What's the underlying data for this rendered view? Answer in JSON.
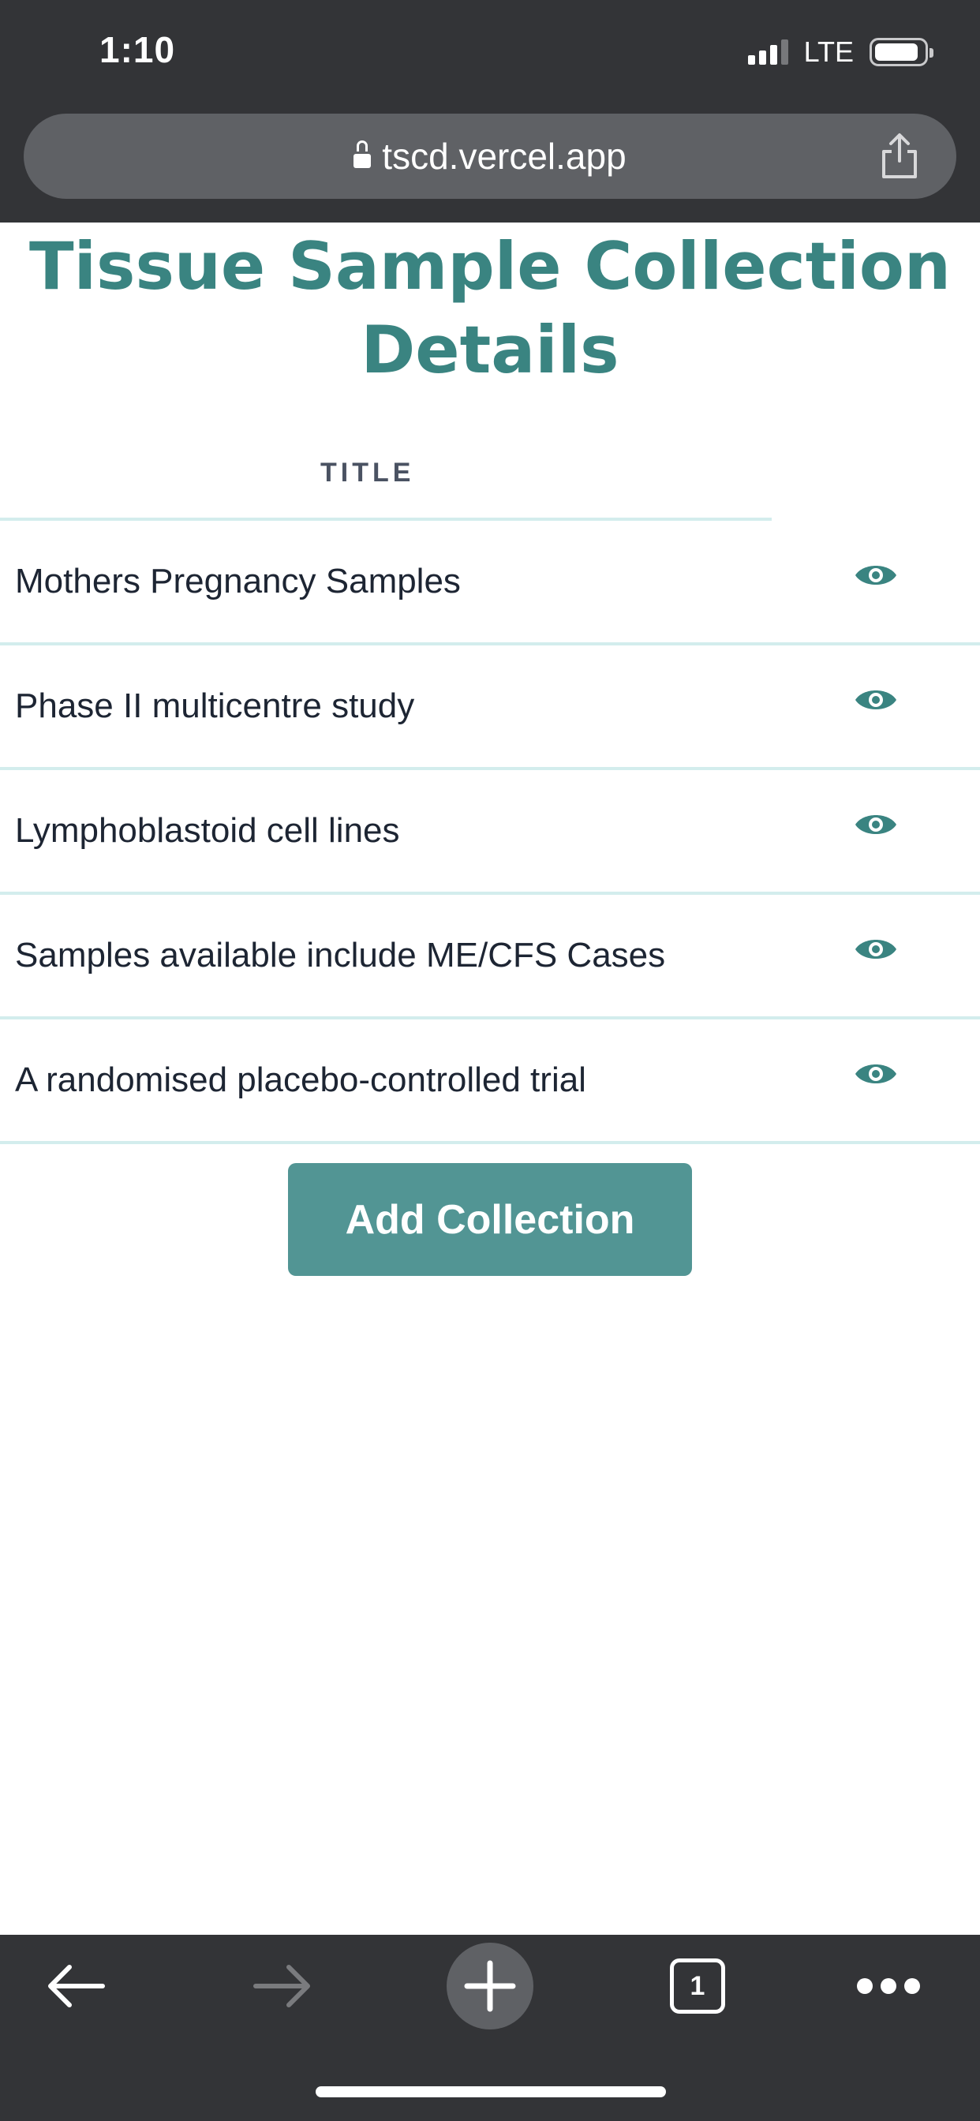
{
  "status_bar": {
    "time": "1:10",
    "network": "LTE"
  },
  "browser": {
    "url": "tscd.vercel.app",
    "tab_count": "1"
  },
  "page": {
    "title": "Tissue Sample Collection Details",
    "column_header": "TITLE",
    "rows": [
      {
        "title": "Mothers Pregnancy Samples",
        "action_icon": "eye-icon"
      },
      {
        "title": "Phase II multicentre study",
        "action_icon": "eye-icon"
      },
      {
        "title": "Lymphoblastoid cell lines",
        "action_icon": "eye-icon"
      },
      {
        "title": "Samples available include ME/CFS Cases",
        "action_icon": "eye-icon"
      },
      {
        "title": "A randomised placebo-controlled trial",
        "action_icon": "eye-icon"
      }
    ],
    "add_button_label": "Add Collection"
  },
  "colors": {
    "accent": "#3a8481",
    "button": "#529594",
    "divider": "#d3eded",
    "chrome": "#333437"
  }
}
